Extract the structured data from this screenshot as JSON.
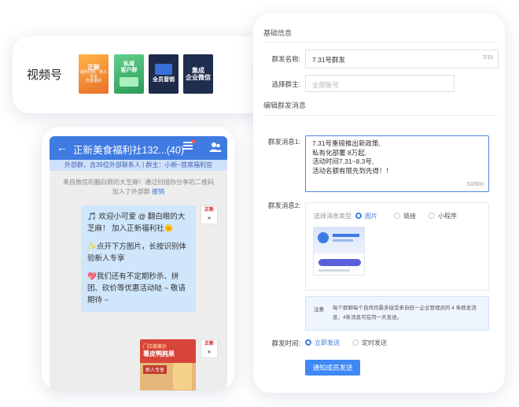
{
  "channels": {
    "label": "视频号",
    "covers": [
      {
        "lines": [
          "正新",
          "福利社群 · 新人专享",
          "优惠福利"
        ],
        "bg": "#f29a2e"
      },
      {
        "lines": [
          "私域",
          "客户群",
          ""
        ],
        "bg": "#41b36e"
      },
      {
        "lines": [
          "全员营销",
          "",
          ""
        ],
        "bg": "#1d2a4a"
      },
      {
        "lines": [
          "集成",
          "企业微信",
          ""
        ],
        "bg": "#1f2d4e"
      }
    ]
  },
  "phone": {
    "back_icon": "back-arrow-icon",
    "title": "正新美食福利社132...(40)",
    "subtitle": "外部群，含39位外部联系人 | 群主：小新~首席福利官",
    "notice": "来自微信的翻白眼的大芝麻！通过扫描你分享的二维码加入了外部群",
    "notice_action": "撤销",
    "bubble": [
      "🎵 欢迎小可爱 @ 翻白眼的大芝麻！ 加入正新福利社🌞",
      "✨点开下方图片，长按识别体验新人专享",
      "💖我们还有不定期秒杀、拼团、砍价等优惠活动哒 ~ 敬请期待 ~"
    ],
    "avatar_text": "正新",
    "poster": {
      "line1": "门店酱酱价",
      "line2": "薯皮鸭肫果",
      "tag": "新人专享"
    }
  },
  "form": {
    "section_basic": "基础信息",
    "name_label": "群发名称:",
    "name_value": "7.31号群发",
    "name_counter": "7/15",
    "owner_label": "选择群主:",
    "owner_placeholder": "全部账号",
    "section_edit": "编辑群发消息",
    "msg1_label": "群发消息1:",
    "msg1_lines": [
      "7.31号重磅推出新政策,",
      "私有化部署  8万起,",
      "活动时间7.31~8.3号,",
      "活动名额有限先到先得！！"
    ],
    "msg1_counter": "53/600",
    "msg2_label": "群发消息2:",
    "type_label": "选择消息类型",
    "types": [
      "图片",
      "链接",
      "小程序"
    ],
    "selected_type": "图片",
    "note_title": "注意",
    "note_body": "每个群聊每个自然月最多接受来自统一企业管理员的 4 条群发消息，4条消息可在同一天发送。",
    "send_time_label": "群发时间:",
    "send_options": [
      "立即发送",
      "定时发送"
    ],
    "selected_send": "立即发送",
    "submit": "通知成员发送"
  },
  "colors": {
    "accent": "#3f7be0",
    "button": "#3f88f5",
    "bubble": "#cfe6fb"
  }
}
